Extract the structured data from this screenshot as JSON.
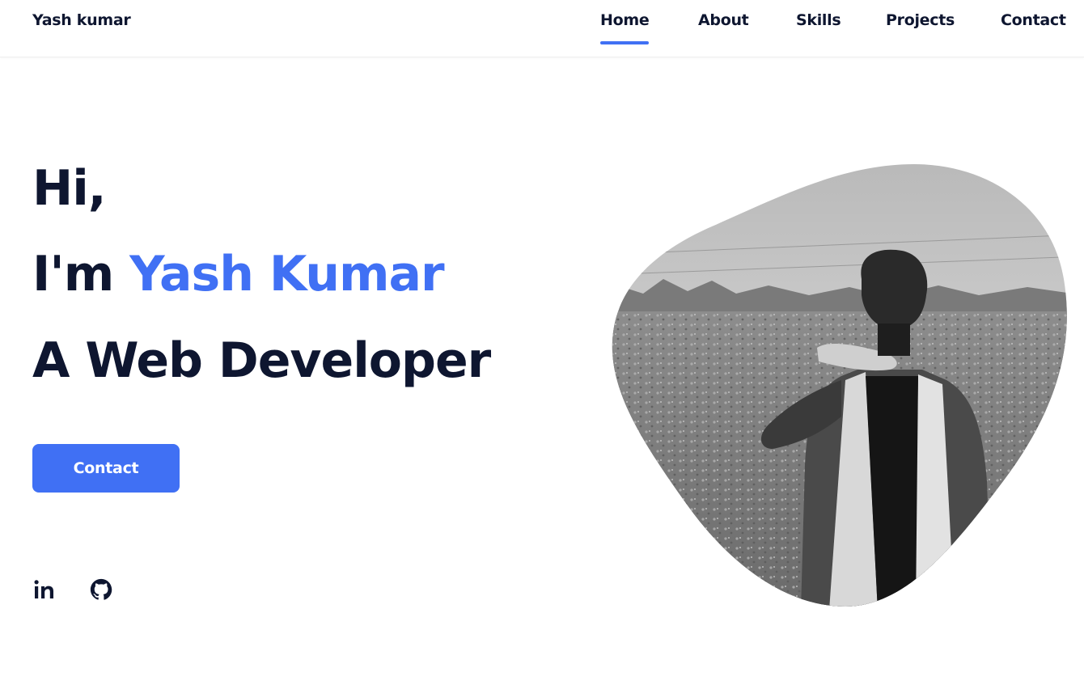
{
  "header": {
    "logo": "Yash kumar",
    "nav": [
      {
        "label": "Home",
        "active": true
      },
      {
        "label": "About",
        "active": false
      },
      {
        "label": "Skills",
        "active": false
      },
      {
        "label": "Projects",
        "active": false
      },
      {
        "label": "Contact",
        "active": false
      }
    ]
  },
  "hero": {
    "greeting": "Hi,",
    "intro_prefix": "I'm ",
    "name": "Yash Kumar",
    "role": "A Web Developer",
    "cta_label": "Contact",
    "social": [
      {
        "icon": "linkedin-icon"
      },
      {
        "icon": "github-icon"
      }
    ],
    "photo": {
      "style": "grayscale",
      "subject": "person-in-field"
    }
  },
  "colors": {
    "accent": "#4070f4",
    "text": "#0e1630",
    "background": "#ffffff"
  }
}
